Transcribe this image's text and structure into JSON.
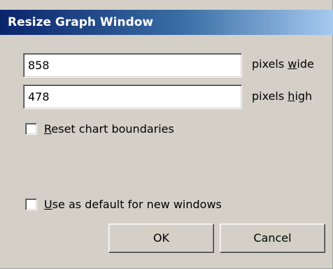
{
  "window": {
    "title": "Resize Graph Window"
  },
  "fields": {
    "width_value": "858",
    "width_label_pre": "pixels ",
    "width_label_accel": "w",
    "width_label_post": "ide",
    "height_value": "478",
    "height_label_pre": "pixels ",
    "height_label_accel": "h",
    "height_label_post": "igh"
  },
  "checkboxes": {
    "reset_accel": "R",
    "reset_rest": "eset chart boundaries",
    "reset_checked": false,
    "default_accel": "U",
    "default_rest": "se as default for new windows",
    "default_checked": false
  },
  "buttons": {
    "ok_label": "OK",
    "cancel_label": "Cancel"
  }
}
